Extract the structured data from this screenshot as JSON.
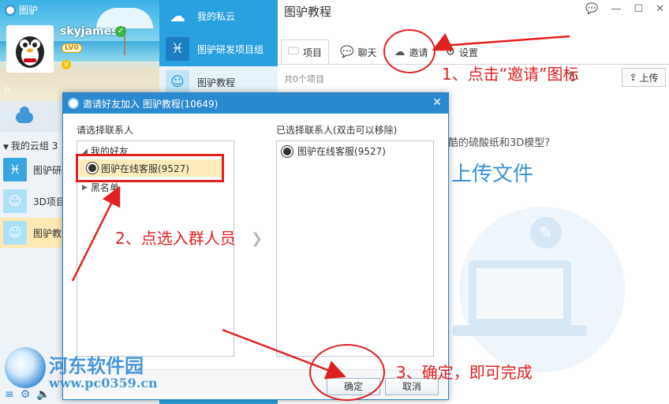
{
  "app": {
    "title": "图驴"
  },
  "profile": {
    "username": "skyjames",
    "level_badge": "LV0",
    "vip_badge": "V"
  },
  "sidebar": {
    "group_header": "我的云组 3",
    "groups": [
      {
        "label": "图驴研",
        "icon": "pisces-icon"
      },
      {
        "label": "3D项目",
        "icon": "avatar-icon"
      },
      {
        "label": "图驴教",
        "icon": "avatar-icon"
      }
    ]
  },
  "midlist": {
    "items": [
      {
        "label": "我的私云",
        "icon": "cloud-icon"
      },
      {
        "label": "图驴研发项目组",
        "icon": "pisces-icon"
      },
      {
        "label": "图驴教程",
        "icon": "avatar-icon"
      }
    ]
  },
  "main": {
    "title": "图驴教程",
    "tabs": [
      {
        "label": "项目",
        "icon": "folder-icon"
      },
      {
        "label": "聊天",
        "icon": "chat-icon"
      },
      {
        "label": "邀请",
        "icon": "cloud-add-icon"
      },
      {
        "label": "设置",
        "icon": "gear-icon"
      }
    ],
    "file_count": "共0个项目",
    "upload_label": "上传",
    "hint_text": "酷的硫酸纸和3D模型?",
    "hint_big": "上传文件"
  },
  "dialog": {
    "title": "邀请好友加入 图驴教程(10649)",
    "left_label": "请选择联系人",
    "right_label": "已选择联系人(双击可以移除)",
    "tree": {
      "friends": "我的好友",
      "blacklist": "黑名单"
    },
    "contact": "图驴在线客服(9527)",
    "picked": "图驴在线客服(9527)",
    "ok_label": "确定",
    "cancel_label": "取消"
  },
  "annotations": {
    "step1": "1、点击“邀请”图标",
    "step2": "2、点选入群人员",
    "step3": "3、确定，即可完成",
    "color": "#e02020"
  },
  "watermark": {
    "title": "河东软件园",
    "url": "www.pc0359.cn"
  },
  "colors": {
    "accent": "#2aa1df",
    "dialog_header": "#2b89cf",
    "selected_row": "#fdecb9"
  }
}
